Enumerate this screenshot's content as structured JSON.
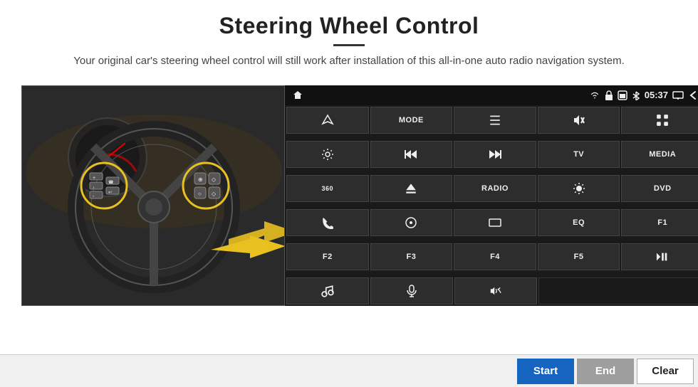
{
  "header": {
    "title": "Steering Wheel Control",
    "subtitle": "Your original car's steering wheel control will still work after installation of this all-in-one auto radio navigation system."
  },
  "status_bar": {
    "time": "05:37"
  },
  "buttons": [
    [
      {
        "label": "▲",
        "type": "icon",
        "name": "nav-icon"
      },
      {
        "label": "MODE",
        "type": "text",
        "name": "mode-btn"
      },
      {
        "label": "≡",
        "type": "icon",
        "name": "list-icon"
      },
      {
        "label": "🔇",
        "type": "icon",
        "name": "mute-icon"
      },
      {
        "label": "⠿",
        "type": "icon",
        "name": "apps-icon"
      }
    ],
    [
      {
        "label": "⚙",
        "type": "icon",
        "name": "settings-icon"
      },
      {
        "label": "⏮",
        "type": "icon",
        "name": "prev-icon"
      },
      {
        "label": "⏭",
        "type": "icon",
        "name": "next-icon"
      },
      {
        "label": "TV",
        "type": "text",
        "name": "tv-btn"
      },
      {
        "label": "MEDIA",
        "type": "text",
        "name": "media-btn"
      }
    ],
    [
      {
        "label": "360",
        "type": "text",
        "name": "360-btn"
      },
      {
        "label": "⏏",
        "type": "icon",
        "name": "eject-icon"
      },
      {
        "label": "RADIO",
        "type": "text",
        "name": "radio-btn"
      },
      {
        "label": "☀",
        "type": "icon",
        "name": "brightness-icon"
      },
      {
        "label": "DVD",
        "type": "text",
        "name": "dvd-btn"
      }
    ],
    [
      {
        "label": "☎",
        "type": "icon",
        "name": "phone-icon"
      },
      {
        "label": "◎",
        "type": "icon",
        "name": "nav2-icon"
      },
      {
        "label": "▬",
        "type": "icon",
        "name": "dash-icon"
      },
      {
        "label": "EQ",
        "type": "text",
        "name": "eq-btn"
      },
      {
        "label": "F1",
        "type": "text",
        "name": "f1-btn"
      }
    ],
    [
      {
        "label": "F2",
        "type": "text",
        "name": "f2-btn"
      },
      {
        "label": "F3",
        "type": "text",
        "name": "f3-btn"
      },
      {
        "label": "F4",
        "type": "text",
        "name": "f4-btn"
      },
      {
        "label": "F5",
        "type": "text",
        "name": "f5-btn"
      },
      {
        "label": "▶⏸",
        "type": "icon",
        "name": "playpause-icon"
      }
    ]
  ],
  "last_row": [
    {
      "label": "♪",
      "type": "icon",
      "name": "music-icon"
    },
    {
      "label": "🎤",
      "type": "icon",
      "name": "mic-icon"
    },
    {
      "label": "🔈/↩",
      "type": "icon",
      "name": "vol-icon"
    },
    {
      "label": "",
      "type": "empty",
      "name": "empty-btn"
    }
  ],
  "actions": {
    "start_label": "Start",
    "end_label": "End",
    "clear_label": "Clear"
  }
}
